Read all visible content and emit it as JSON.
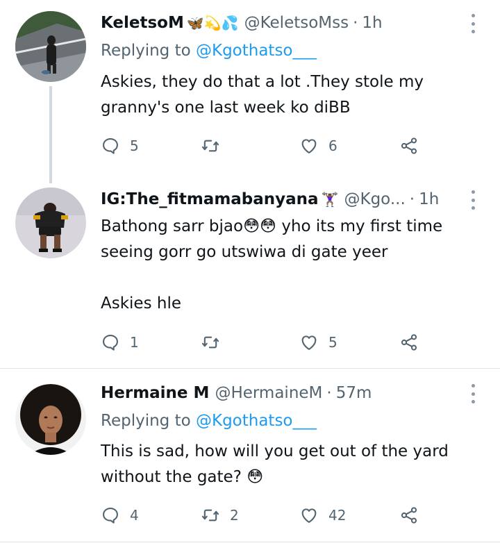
{
  "tweets": [
    {
      "name": "KeletsoM",
      "emojis": "🦋💫💦",
      "handle": "@KeletsoMss",
      "dot": "·",
      "time": "1h",
      "reply_prefix": "Replying to",
      "reply_to": "@Kgothatso___",
      "lines": [
        "Askies, they do that a lot .They stole my",
        "granny's one last week ko diBB"
      ],
      "replies": "5",
      "retweets": "",
      "likes": "6"
    },
    {
      "name": "IG:The_fitmamabanyana",
      "emojis": "🏋🏾‍♀️",
      "handle": "@Kgo...",
      "dot": "·",
      "time": "1h",
      "lines": [
        "Bathong sarr bjao😳😳 yho its my first time",
        "seeing gorr go utswiwa di gate yeer",
        "",
        "Askies hle"
      ],
      "replies": "1",
      "retweets": "",
      "likes": "5"
    },
    {
      "name": "Hermaine M",
      "handle": "@HermaineM",
      "dot": "·",
      "time": "57m",
      "reply_prefix": "Replying to",
      "reply_to": "@Kgothatso___",
      "lines": [
        "This is sad, how will you get out of the yard",
        "without the gate? 😳"
      ],
      "replies": "4",
      "retweets": "2",
      "likes": "42"
    }
  ],
  "icons": {
    "reply": "comment-bubble-icon",
    "retweet": "retweet-icon",
    "like": "heart-icon",
    "share": "share-icon",
    "more": "more-vertical-icon"
  },
  "colors": {
    "text": "#0f1419",
    "muted": "#536471",
    "link": "#1d9bf0",
    "thread_line": "#cfd9de",
    "divider": "#dde3e8"
  }
}
